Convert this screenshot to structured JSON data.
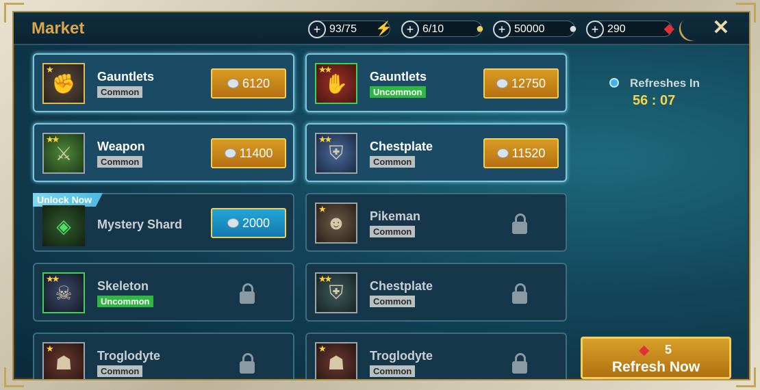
{
  "header": {
    "title": "Market",
    "resources": [
      {
        "value": "93/75",
        "icon": "energy-icon"
      },
      {
        "value": "6/10",
        "icon": "arena-token-icon"
      },
      {
        "value": "50000",
        "icon": "silver-icon"
      },
      {
        "value": "290",
        "icon": "gem-icon"
      }
    ],
    "close_glyph": "✕"
  },
  "items": [
    {
      "name": "Gauntlets",
      "rarity": "Common",
      "price": "6120",
      "stars": "★"
    },
    {
      "name": "Gauntlets",
      "rarity": "Uncommon",
      "price": "12750",
      "stars": "★★"
    },
    {
      "name": "Weapon",
      "rarity": "Common",
      "price": "11400",
      "stars": "★★"
    },
    {
      "name": "Chestplate",
      "rarity": "Common",
      "price": "11520",
      "stars": "★★"
    },
    {
      "name": "Mystery Shard",
      "price": "2000",
      "ribbon": "Unlock Now"
    },
    {
      "name": "Pikeman",
      "rarity": "Common",
      "stars": "★"
    },
    {
      "name": "Skeleton",
      "rarity": "Uncommon",
      "stars": "★★"
    },
    {
      "name": "Chestplate",
      "rarity": "Common",
      "stars": "★★"
    },
    {
      "name": "Troglodyte",
      "rarity": "Common",
      "stars": "★"
    },
    {
      "name": "Troglodyte",
      "rarity": "Common",
      "stars": "★"
    }
  ],
  "refresh": {
    "label": "Refreshes In",
    "timer": "56 : 07",
    "button_count": "5",
    "button_label": "Refresh Now"
  }
}
